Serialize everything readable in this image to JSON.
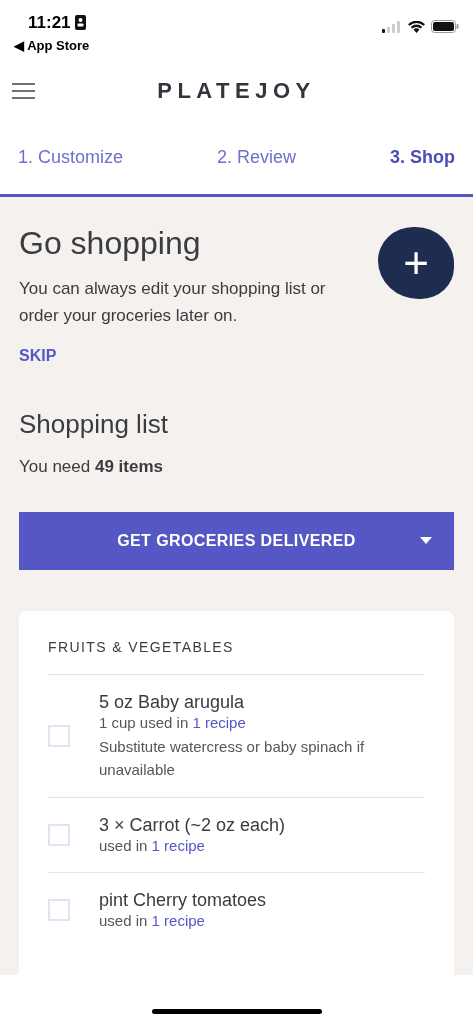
{
  "status_bar": {
    "time": "11:21",
    "back_label": "◀ App Store"
  },
  "header": {
    "logo": "PLATEJOY"
  },
  "steps": [
    {
      "label": "1. Customize",
      "selected": false
    },
    {
      "label": "2. Review",
      "selected": false
    },
    {
      "label": "3. Shop",
      "selected": true
    }
  ],
  "intro": {
    "title": "Go shopping",
    "text": "You can always edit your shopping list or order your groceries later on.",
    "skip": "SKIP",
    "add_button": "+"
  },
  "shopping_list": {
    "title": "Shopping list",
    "summary": "You need **49 items**",
    "deliver_button": "GET GROCERIES DELIVERED"
  },
  "section": {
    "title": "FRUITS & VEGETABLES",
    "items": [
      {
        "name": "5 oz Baby arugula",
        "usage": "1 cup used in ",
        "link": "1 recipe",
        "note": "Substitute watercress or baby spinach if unavailable",
        "checked": false
      },
      {
        "name": "3 × Carrot (~2 oz each)",
        "usage": "used in ",
        "link": "1 recipe",
        "checked": false
      },
      {
        "name": "pint Cherry tomatoes",
        "usage": "used in ",
        "link": "1 recipe",
        "checked": false
      }
    ]
  }
}
